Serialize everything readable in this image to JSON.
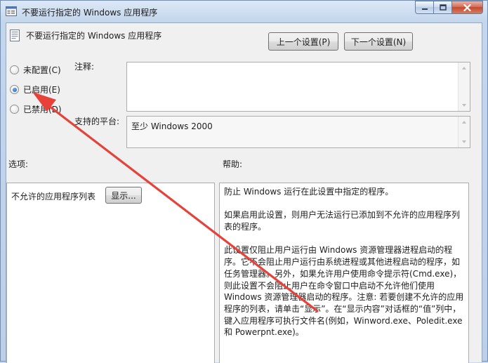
{
  "window": {
    "title": "不要运行指定的 Windows 应用程序"
  },
  "header": {
    "setting_title": "不要运行指定的 Windows 应用程序",
    "prev_button": "上一个设置(P)",
    "next_button": "下一个设置(N)"
  },
  "state": {
    "options": [
      {
        "label": "未配置(C)",
        "checked": false
      },
      {
        "label": "已启用(E)",
        "checked": true
      },
      {
        "label": "已禁用(D)",
        "checked": false
      }
    ]
  },
  "comment": {
    "label": "注释:",
    "value": ""
  },
  "platform": {
    "label": "支持的平台:",
    "value": "至少 Windows 2000"
  },
  "options_section": {
    "heading": "选项:",
    "item_label": "不允许的应用程序列表",
    "show_button": "显示..."
  },
  "help_section": {
    "heading": "帮助:",
    "paragraphs": [
      "防止 Windows 运行在此设置中指定的程序。",
      "如果启用此设置，则用户无法运行已添加到不允许的应用程序列表的程序。",
      "此设置仅阻止用户运行由 Windows 资源管理器进程启动的程序。它不会阻止用户运行由系统进程或其他进程启动的程序，如任务管理器。另外，如果允许用户使用命令提示符(Cmd.exe)，则此设置不会阻止用户在命令窗口中启动不允许他们使用 Windows 资源管理器启动的程序。注意: 若要创建不允许的应用程序的列表，请单击“显示”。在“显示内容”对话框的“值”列中，键入应用程序可执行文件名(例如，Winword.exe、Poledit.exe 和 Powerpnt.exe)。"
    ]
  },
  "colors": {
    "annotation_arrow": "#e8413a",
    "radio_selected": "#1d5fb8"
  }
}
